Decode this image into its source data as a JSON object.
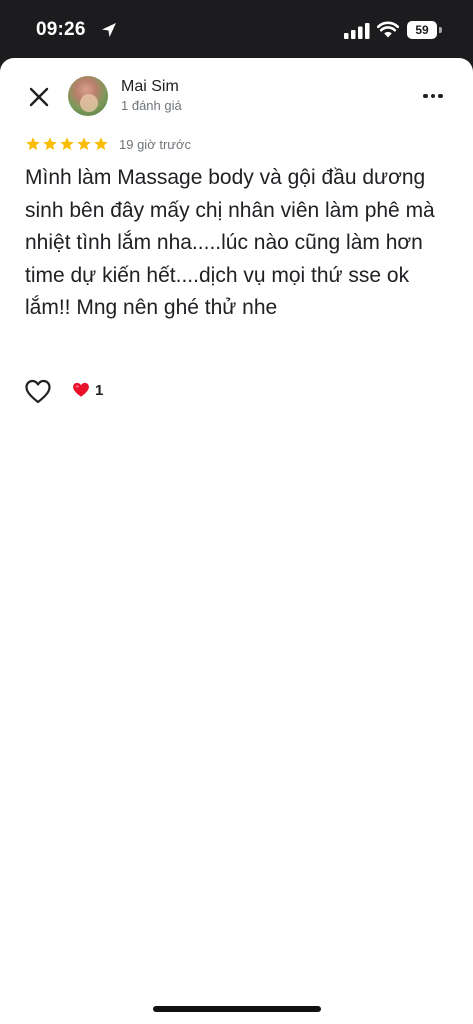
{
  "status_bar": {
    "time": "09:26",
    "battery": "59",
    "icons": [
      "location-arrow-icon",
      "signal-icon",
      "wifi-icon",
      "battery-icon"
    ]
  },
  "header": {
    "close_icon": "close-icon",
    "user_name": "Mai Sim",
    "user_meta": "1 đánh giá",
    "more_icon": "more-horizontal-icon"
  },
  "review": {
    "rating": 5,
    "star_color": "#fbbc04",
    "time": "19 giờ trước",
    "text": "Mình làm Massage body và gội đầu dương sinh bên đây mấy chị nhân viên làm phê mà nhiệt tình lắm nha.....lúc nào cũng làm hơn time dự kiến hết....dịch vụ mọi thứ sse ok lắm!! Mng nên ghé thử nhe"
  },
  "actions": {
    "like_icon": "heart-outline-icon",
    "reaction_icon": "red-heart-icon",
    "reaction_count": "1",
    "reaction_color": "#e8102a"
  }
}
